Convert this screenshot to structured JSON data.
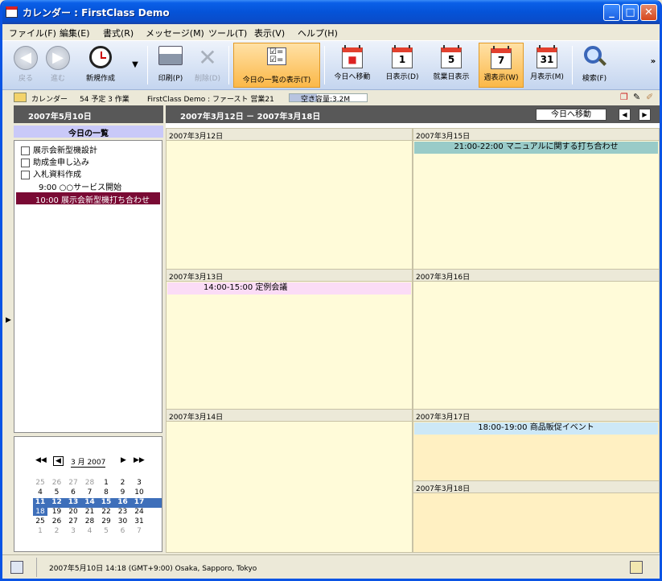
{
  "window": {
    "title": "カレンダー : FirstClass Demo"
  },
  "menu": [
    "ファイル(F)",
    "編集(E)",
    "書式(R)",
    "メッセージ(M)",
    "ツール(T)",
    "表示(V)",
    "ヘルプ(H)"
  ],
  "toolbar": {
    "back": "戻る",
    "forward": "進む",
    "new": "新規作成",
    "print": "印刷(P)",
    "delete": "削除(D)",
    "today_list": "今日の一覧の表示(T)",
    "goto_today": "今日へ移動",
    "day_view": "日表示(D)",
    "workweek_view": "就業日表示",
    "week_view": "週表示(W)",
    "month_view": "月表示(M)",
    "search": "検索(F)",
    "day_icon_num": "1",
    "workweek_icon_num": "5",
    "week_icon_num": "7",
    "month_icon_num": "31"
  },
  "infobar": {
    "title": "カレンダー",
    "counts": "54 予定 3 作業",
    "path": "FirstClass Demo : ファースト 営業21",
    "capacity": "空き容量:3.2M",
    "capacity_fraction": 0.35
  },
  "left": {
    "date_header": "2007年5月10日",
    "today_header": "今日の一覧",
    "tasks": [
      "展示会新型機設計",
      "助成金申し込み",
      "入札資料作成"
    ],
    "event_plain": "9:00 ○○サービス開始",
    "event_selected": "10:00 展示会新型機打ち合わせ"
  },
  "minical": {
    "month_label": "3 月 2007",
    "rows": [
      [
        "25",
        "26",
        "27",
        "28",
        "1",
        "2",
        "3"
      ],
      [
        "4",
        "5",
        "6",
        "7",
        "8",
        "9",
        "10"
      ],
      [
        "11",
        "12",
        "13",
        "14",
        "15",
        "16",
        "17"
      ],
      [
        "18",
        "19",
        "20",
        "21",
        "22",
        "23",
        "24"
      ],
      [
        "25",
        "26",
        "27",
        "28",
        "29",
        "30",
        "31"
      ],
      [
        "1",
        "2",
        "3",
        "4",
        "5",
        "6",
        "7"
      ]
    ]
  },
  "main": {
    "range": "2007年3月12日 － 2007年3月18日",
    "goto_today": "今日へ移動",
    "days": {
      "d12": "2007年3月12日",
      "d13": "2007年3月13日",
      "d14": "2007年3月14日",
      "d15": "2007年3月15日",
      "d16": "2007年3月16日",
      "d17": "2007年3月17日",
      "d18": "2007年3月18日"
    },
    "events": {
      "e15": "21:00-22:00 マニュアルに関する打ち合わせ",
      "e13": "14:00-15:00 定例会議",
      "e17": "18:00-19:00 商品販促イベント"
    }
  },
  "status": {
    "text": "2007年5月10日 14:18 (GMT+9:00) Osaka, Sapporo, Tokyo"
  },
  "colors": {
    "titlebar": "#0553d8",
    "selected_event": "#7a0a34",
    "active_tool": "#fbb848",
    "day_bg": "#fffbd9"
  }
}
